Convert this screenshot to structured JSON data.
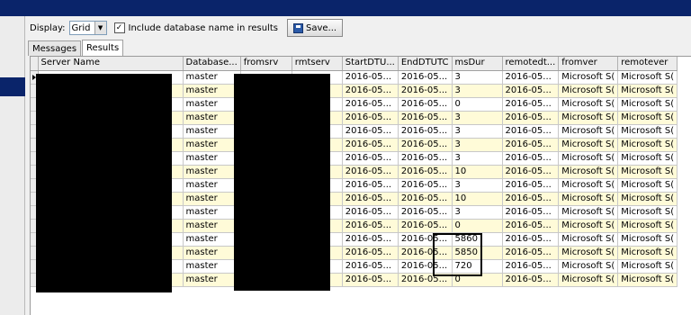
{
  "toolbar": {
    "display_label": "Display:",
    "display_value": "Grid",
    "include_checked": "✓",
    "include_label": "Include database name in results",
    "save_label": "Save..."
  },
  "tabs": [
    "Messages",
    "Results"
  ],
  "grid": {
    "columns": [
      "Server Name",
      "Database...",
      "fromsrv",
      "rmtserv",
      "StartDTU...",
      "EndDTUTC",
      "msDur",
      "remotedt...",
      "fromver",
      "remotever"
    ],
    "rows": [
      [
        "",
        "master",
        "",
        "",
        "2016-05...",
        "2016-05...",
        "3",
        "2016-05...",
        "Microsoft S(",
        "Microsoft S("
      ],
      [
        "",
        "master",
        "",
        "",
        "2016-05...",
        "2016-05...",
        "3",
        "2016-05...",
        "Microsoft S(",
        "Microsoft S("
      ],
      [
        "",
        "master",
        "",
        "",
        "2016-05...",
        "2016-05...",
        "0",
        "2016-05...",
        "Microsoft S(",
        "Microsoft S("
      ],
      [
        "",
        "master",
        "",
        "",
        "2016-05...",
        "2016-05...",
        "3",
        "2016-05...",
        "Microsoft S(",
        "Microsoft S("
      ],
      [
        "",
        "master",
        "",
        "",
        "2016-05...",
        "2016-05...",
        "3",
        "2016-05...",
        "Microsoft S(",
        "Microsoft S("
      ],
      [
        "",
        "master",
        "",
        "",
        "2016-05...",
        "2016-05...",
        "3",
        "2016-05...",
        "Microsoft S(",
        "Microsoft S("
      ],
      [
        "",
        "master",
        "",
        "",
        "2016-05...",
        "2016-05...",
        "3",
        "2016-05...",
        "Microsoft S(",
        "Microsoft S("
      ],
      [
        "",
        "master",
        "",
        "",
        "2016-05...",
        "2016-05...",
        "10",
        "2016-05...",
        "Microsoft S(",
        "Microsoft S("
      ],
      [
        "",
        "master",
        "",
        "",
        "2016-05...",
        "2016-05...",
        "3",
        "2016-05...",
        "Microsoft S(",
        "Microsoft S("
      ],
      [
        "",
        "master",
        "",
        "",
        "2016-05...",
        "2016-05...",
        "10",
        "2016-05...",
        "Microsoft S(",
        "Microsoft S("
      ],
      [
        "",
        "master",
        "",
        "",
        "2016-05...",
        "2016-05...",
        "3",
        "2016-05...",
        "Microsoft S(",
        "Microsoft S("
      ],
      [
        "",
        "master",
        "",
        "",
        "2016-05...",
        "2016-05...",
        "0",
        "2016-05...",
        "Microsoft S(",
        "Microsoft S("
      ],
      [
        "",
        "master",
        "",
        "",
        "2016-05...",
        "2016-05...",
        "5860",
        "2016-05...",
        "Microsoft S(",
        "Microsoft S("
      ],
      [
        "",
        "master",
        "",
        "",
        "2016-05...",
        "2016-05...",
        "5850",
        "2016-05...",
        "Microsoft S(",
        "Microsoft S("
      ],
      [
        "",
        "master",
        "",
        "",
        "2016-05...",
        "2016-05...",
        "720",
        "2016-05...",
        "Microsoft S(",
        "Microsoft S("
      ],
      [
        "",
        "master",
        "",
        "",
        "2016-05...",
        "2016-05...",
        "0",
        "2016-05...",
        "Microsoft S(",
        "Microsoft S("
      ]
    ]
  },
  "colors": {
    "title_bar": "#0a246a",
    "alt_row": "#fffbd8",
    "redaction": "#000000"
  }
}
